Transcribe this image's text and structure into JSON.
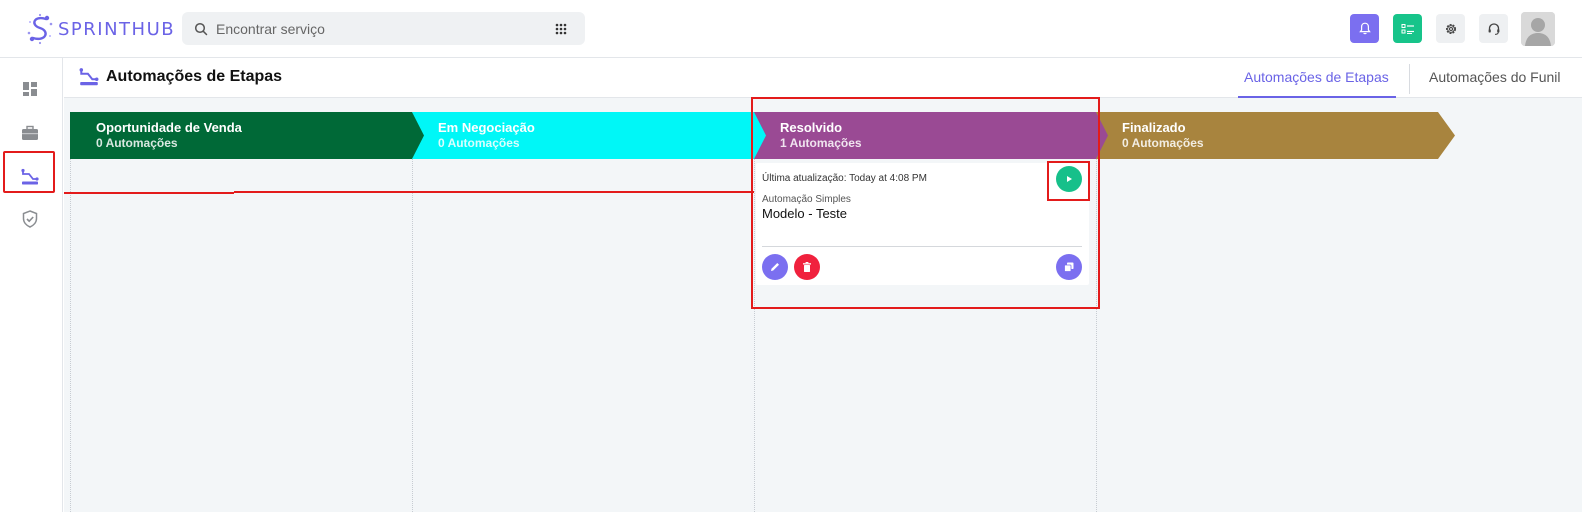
{
  "brand": {
    "logo_text": "SPRINTHUB",
    "primary_color": "#6b63e6"
  },
  "search": {
    "placeholder": "Encontrar serviço"
  },
  "topbar_icons": [
    "bell-icon",
    "tasks-icon",
    "gear-icon",
    "headset-icon",
    "user-avatar"
  ],
  "sidebar": {
    "items": [
      {
        "icon": "dashboard-icon"
      },
      {
        "icon": "briefcase-icon"
      },
      {
        "icon": "automation-icon",
        "active": true
      },
      {
        "icon": "shield-check-icon"
      }
    ]
  },
  "page": {
    "title": "Automações de Etapas",
    "tabs": [
      {
        "label": "Automações de Etapas",
        "active": true
      },
      {
        "label": "Automações do Funil",
        "active": false
      }
    ]
  },
  "stages": [
    {
      "name": "Oportunidade de Venda",
      "count": "0 Automações",
      "color": "#006937"
    },
    {
      "name": "Em Negociação",
      "count": "0 Automações",
      "color": "#00f7f7"
    },
    {
      "name": "Resolvido",
      "count": "1 Automações",
      "color": "#9a4a94"
    },
    {
      "name": "Finalizado",
      "count": "0 Automações",
      "color": "#a8843e"
    }
  ],
  "card": {
    "updated": "Última atualização: Today at 4:08 PM",
    "type": "Automação Simples",
    "name": "Modelo - Teste"
  },
  "colors": {
    "highlight": "#e31b1b",
    "play": "#16c08a",
    "delete": "#f0213d",
    "accent": "#7b6ff0"
  }
}
